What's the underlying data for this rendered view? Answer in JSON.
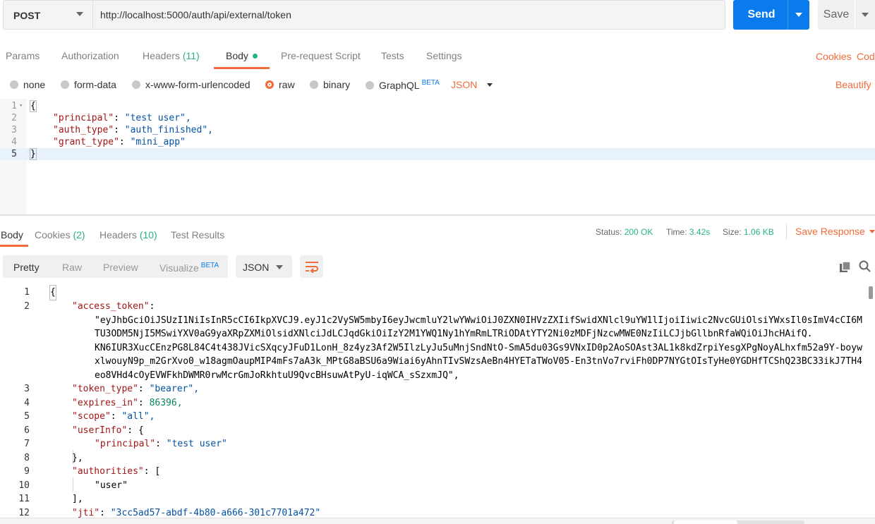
{
  "request": {
    "method": "POST",
    "url": "http://localhost:5000/auth/api/external/token",
    "send_label": "Send",
    "save_label": "Save"
  },
  "request_tabs": [
    {
      "label": "Params"
    },
    {
      "label": "Authorization"
    },
    {
      "label": "Headers",
      "count": "(11)"
    },
    {
      "label": "Body"
    },
    {
      "label": "Pre-request Script"
    },
    {
      "label": "Tests"
    },
    {
      "label": "Settings"
    }
  ],
  "right_links": {
    "cookies": "Cookies",
    "code": "Code"
  },
  "body_types": {
    "none": "none",
    "form_data": "form-data",
    "urlencoded": "x-www-form-urlencoded",
    "raw": "raw",
    "binary": "binary",
    "graphql": "GraphQL",
    "beta": "BETA",
    "format": "JSON",
    "beautify": "Beautify"
  },
  "request_body": {
    "line_numbers": [
      "1",
      "2",
      "3",
      "4",
      "5"
    ],
    "open": "{",
    "close": "}",
    "fields": [
      {
        "key": "\"principal\"",
        "value": "\"test user\","
      },
      {
        "key": "\"auth_type\"",
        "value": "\"auth_finished\","
      },
      {
        "key": "\"grant_type\"",
        "value": "\"mini_app\""
      }
    ]
  },
  "response_tabs": {
    "body": "Body",
    "cookies": "Cookies",
    "cookies_count": "(2)",
    "headers": "Headers",
    "headers_count": "(10)",
    "tests": "Test Results"
  },
  "status": {
    "status_label": "Status:",
    "status_value": "200 OK",
    "time_label": "Time:",
    "time_value": "3.42s",
    "size_label": "Size:",
    "size_value": "1.06 KB",
    "save_response": "Save Response"
  },
  "view_modes": {
    "pretty": "Pretty",
    "raw": "Raw",
    "preview": "Preview",
    "visualize": "Visualize",
    "beta": "BETA",
    "format": "JSON"
  },
  "response_body": {
    "l1": {
      "n": "1",
      "t": "{"
    },
    "l2": {
      "n": "2",
      "key": "\"access_token\"",
      "colon": ":"
    },
    "token_lines": [
      "\"eyJhbGciOiJSUzI1NiIsInR5cCI6IkpXVCJ9.eyJ1c2VySW5mbyI6eyJwcmluY2lwYWwiOiJ0ZXN0IHVzZXIifSwidXNlcl9uYW1lIjoiIiwic2NvcGUiOlsiYWxsIl0sImV4cCI6M",
      "TU3ODM5NjI5MSwiYXV0aG9yaXRpZXMiOlsidXNlciJdLCJqdGkiOiIzY2M1YWQ1Ny1hYmRmLTRiODAtYTY2Ni0zMDFjNzcwMWE0NzIiLCJjbGllbnRfaWQiOiJhcHAifQ.",
      "KN6IUR3XucCEnzPG8L84C4t438JVicSXqcyJFuD1LonH_8z4yz3Af2W5IlzLyJu5uMnjSndNtO-SmA5du03Gs9VNxID0p2AoSOAst3AL1k8kdZrpiYesgXPgNoyALhxfm52a9Y-boyw",
      "xlwouyN9p_m2GrXvo0_w18agmOaupMIP4mFs7aA3k_MPtG8aBSU6a9Wiai6yAhnTIvSWzsAeBn4HYETaTWoV05-En3tnVo7rviFh0DP7NYGtOIsTyHe0YGDHfTCShQ23BC33ikJ7TH4",
      "eo8VHd4cOyEVWFkhDWMR0rwMcrGmJoRkhtuU9QvcBHsuwAtPyU-iqWCA_sSzxmJQ\","
    ],
    "l3": {
      "n": "3",
      "key": "\"token_type\"",
      "value": "\"bearer\","
    },
    "l4": {
      "n": "4",
      "key": "\"expires_in\"",
      "value": "86396,"
    },
    "l5": {
      "n": "5",
      "key": "\"scope\"",
      "value": "\"all\","
    },
    "l6": {
      "n": "6",
      "key": "\"userInfo\"",
      "value": "{"
    },
    "l7": {
      "n": "7",
      "key": "\"principal\"",
      "value": "\"test user\""
    },
    "l8": {
      "n": "8",
      "t": "},"
    },
    "l9": {
      "n": "9",
      "key": "\"authorities\"",
      "value": "["
    },
    "l10": {
      "n": "10",
      "value": "\"user\""
    },
    "l11": {
      "n": "11",
      "t": "],"
    },
    "l12": {
      "n": "12",
      "key": "\"jti\"",
      "value": "\"3cc5ad57-abdf-4b80-a666-301c7701a472\""
    }
  },
  "colors": {
    "accent": "#f26b3a",
    "send_blue": "#097bed",
    "status_green": "#26b47f",
    "json_key": "#a31515",
    "json_value": "#0451a5"
  }
}
